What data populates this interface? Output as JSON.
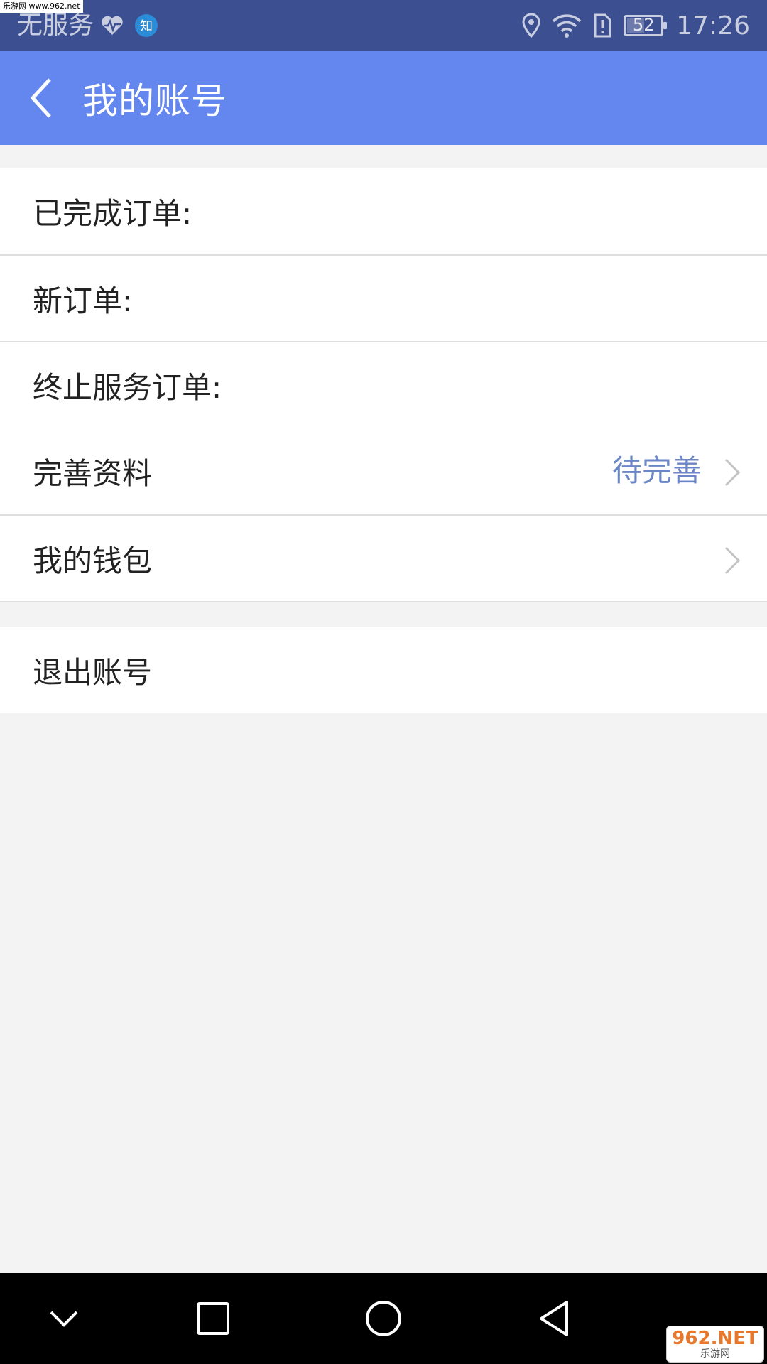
{
  "status_bar": {
    "carrier": "无服务",
    "app_badge": "知",
    "battery_level": 52,
    "battery_text": "52",
    "time": "17:26"
  },
  "header": {
    "title": "我的账号"
  },
  "list": {
    "completed_orders_label": "已完成订单:",
    "new_orders_label": "新订单:",
    "terminated_orders_label": "终止服务订单:",
    "profile_label": "完善资料",
    "profile_status": "待完善",
    "wallet_label": "我的钱包"
  },
  "logout": {
    "label": "退出账号"
  },
  "watermark": {
    "top_text": "乐游网 www.962.net",
    "logo_main": "962.NET",
    "logo_sub": "乐游网"
  },
  "colors": {
    "status_bar": "#3c4f91",
    "toolbar": "#6386ef",
    "accent_text": "#6b86c6",
    "background": "#f3f3f3"
  },
  "icons": {
    "back": "back-arrow-icon",
    "chevron": "chevron-right-icon",
    "heart": "heart-rate-icon",
    "location": "location-icon",
    "wifi": "wifi-icon",
    "sim": "sim-alert-icon"
  }
}
